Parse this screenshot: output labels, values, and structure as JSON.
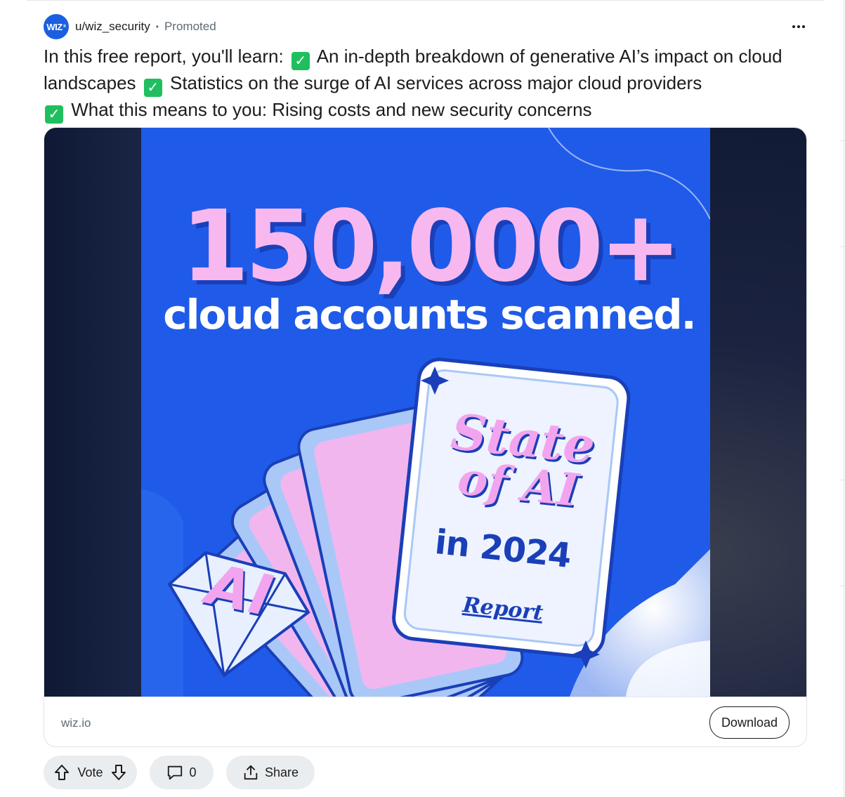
{
  "post": {
    "author": "u/wiz_security",
    "avatar_text": "WIZ",
    "separator": "•",
    "promoted_label": "Promoted",
    "body_parts": [
      "In this free report, you'll learn: ",
      " An in-depth breakdown of generative AI’s impact on cloud landscapes ",
      " Statistics on the surge of AI services across major cloud providers ",
      " What this means to you: Rising costs and new security concerns"
    ],
    "check_glyph": "✓"
  },
  "ad": {
    "headline": "150,000+",
    "subheadline": "cloud accounts scanned.",
    "card_title_line1": "State",
    "card_title_line2": "of AI",
    "card_year": "in 2024",
    "card_label": "Report",
    "diamond_text": "AI",
    "domain": "wiz.io",
    "cta_label": "Download"
  },
  "actions": {
    "vote_label": "Vote",
    "comment_count": "0",
    "share_label": "Share"
  },
  "colors": {
    "ad_blue": "#1f5be8",
    "pink": "#f7b8f0",
    "check_green": "#1fbf5f"
  }
}
